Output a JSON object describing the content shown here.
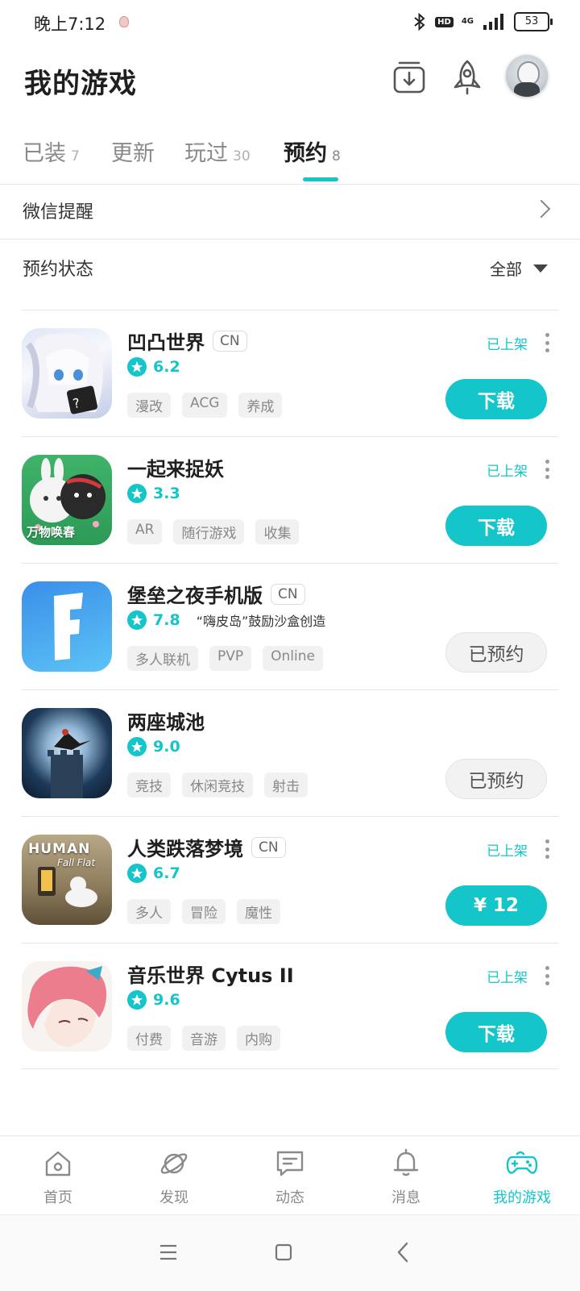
{
  "status_bar": {
    "time": "晚上7:12",
    "battery": "53",
    "network": "4G",
    "hd": "HD"
  },
  "header": {
    "title": "我的游戏"
  },
  "tabs": [
    {
      "label": "已装",
      "count": "7"
    },
    {
      "label": "更新",
      "count": ""
    },
    {
      "label": "玩过",
      "count": "30"
    },
    {
      "label": "预约",
      "count": "8"
    }
  ],
  "wechat": {
    "label": "微信提醒"
  },
  "reserve": {
    "label": "预约状态",
    "filter": "全部"
  },
  "games": [
    {
      "name": "凹凸世界",
      "badge": "CN",
      "rating": "6.2",
      "desc": "",
      "tags": [
        "漫改",
        "ACG",
        "养成"
      ],
      "status": "已上架",
      "action": "下载"
    },
    {
      "name": "一起来捉妖",
      "badge": "",
      "rating": "3.3",
      "desc": "",
      "tags": [
        "AR",
        "随行游戏",
        "收集"
      ],
      "status": "已上架",
      "action": "下载",
      "icon_text": "万物唤春"
    },
    {
      "name": "堡垒之夜手机版",
      "badge": "CN",
      "rating": "7.8",
      "desc": "“嗨皮岛”鼓励沙盒创造",
      "tags": [
        "多人联机",
        "PVP",
        "Online"
      ],
      "status": "",
      "action": "已预约"
    },
    {
      "name": "两座城池",
      "badge": "",
      "rating": "9.0",
      "desc": "",
      "tags": [
        "竞技",
        "休闲竞技",
        "射击"
      ],
      "status": "",
      "action": "已预约"
    },
    {
      "name": "人类跌落梦境",
      "badge": "CN",
      "rating": "6.7",
      "desc": "",
      "tags": [
        "多人",
        "冒险",
        "魔性"
      ],
      "status": "已上架",
      "action": "¥ 12",
      "icon_text_1": "HUMAN",
      "icon_text_2": "Fall Flat"
    },
    {
      "name": "音乐世界 Cytus II",
      "badge": "",
      "rating": "9.6",
      "desc": "",
      "tags": [
        "付费",
        "音游",
        "内购"
      ],
      "status": "已上架",
      "action": "下载"
    }
  ],
  "nav": [
    {
      "label": "首页",
      "icon": "home-icon"
    },
    {
      "label": "发现",
      "icon": "planet-icon"
    },
    {
      "label": "动态",
      "icon": "chat-icon"
    },
    {
      "label": "消息",
      "icon": "bell-icon"
    },
    {
      "label": "我的游戏",
      "icon": "gamepad-icon"
    }
  ],
  "colors": {
    "accent": "#14c5c9",
    "text": "#1f1f1f",
    "muted": "#8a8a8a"
  }
}
